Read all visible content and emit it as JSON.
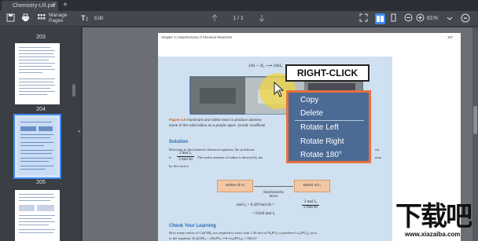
{
  "tabs": [
    {
      "label": "Chemistry-LR.pdf",
      "close": "×"
    }
  ],
  "tab_add": "+",
  "toolbar": {
    "manage_pages_line1": "Manage",
    "manage_pages_line2": "Pages",
    "edit_label": "Edit",
    "page_indicator": "1 / 1",
    "zoom": "81%"
  },
  "sidebar": {
    "page_labels": [
      "203",
      "204",
      "205"
    ]
  },
  "page": {
    "header_left": "Chapter 4 | Stoichiometry of Chemical Reactions",
    "header_right": "197",
    "equation_top": "2Al + 3I₂ ⟶ 2AlI₃",
    "figure_label": "Figure 4.9",
    "figure_caption": "Aluminum and iodine react to produce aluminu",
    "figure_caption2": "some of the solid iodine as a purple vapor. (credit: modificati",
    "solution_heading": "Solution",
    "solution_text1": "Referring to the balanced chemical equation, the stoichiom",
    "solution_text1_end": "est",
    "solution_text2_prefix": "is",
    "solution_text2": "The molar amount of iodine is derived by ma",
    "solution_text2_end": "num",
    "solution_text3": "by this factor:",
    "fraction_top": "3 mol I₂",
    "fraction_bottom": "2 mol Al",
    "flow_left": "Moles of Al",
    "flow_right": "Moles of I₂",
    "flow_mid_line1": "Stoichiometric",
    "flow_mid_line2": "factor",
    "calc_line1": "mol I₂ = 0.429 mol Al ×",
    "calc_line2": "= 0.644 mol I₂",
    "check_heading": "Check Your Learning",
    "check_text1": "How many moles of Ca(OH)₂ are required to react with 1.36 mol of H₃PO₄ to produce Ca₃(PO₄)₂ acco",
    "check_text2": "to the equation 3Ca(OH)₂ + 2H₃PO₄ ⟶ Ca₃(PO₄)₂ + 6H₂O?"
  },
  "overlay": {
    "right_click_label": "RIGHT-CLICK"
  },
  "context_menu": {
    "items": [
      "Copy",
      "Delete",
      "Rotate Left",
      "Rotate Right",
      "Rotate 180°"
    ]
  },
  "watermark": {
    "text": "下载吧",
    "url": "www.xiazaiba.com"
  },
  "colors": {
    "menu_bg": "#4b6b95",
    "menu_border": "#e86f3d",
    "selection": "#3d8bf0"
  }
}
